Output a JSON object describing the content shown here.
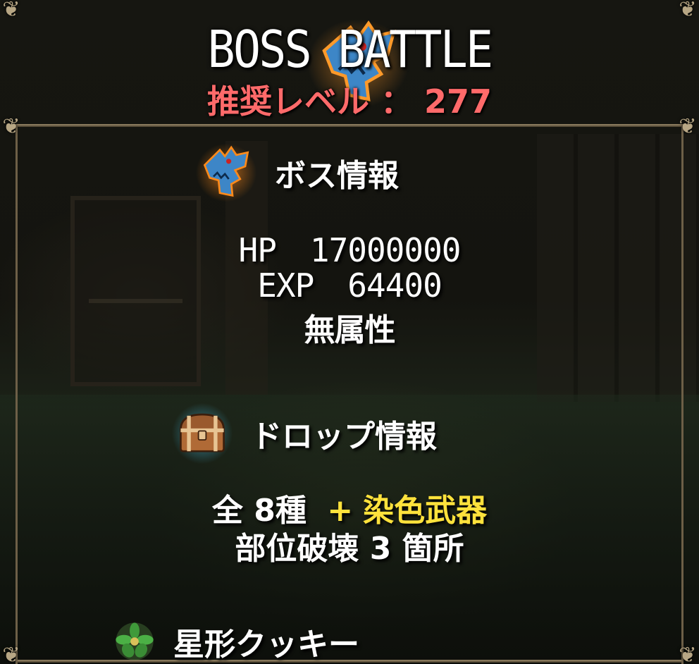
{
  "header": {
    "title_left": "BOSS",
    "title_right": "BATTLE",
    "recommended_level_label": "推奨レベル",
    "recommended_level_separator": "：",
    "recommended_level_value": "277"
  },
  "boss_info": {
    "heading": "ボス情報",
    "icon": "shark-head-icon",
    "hp_label": "HP",
    "hp_value": "17000000",
    "exp_label": "EXP",
    "exp_value": "64400",
    "attribute": "無属性"
  },
  "drop_info": {
    "heading": "ドロップ情報",
    "icon": "treasure-chest-icon",
    "total_prefix": "全",
    "total_kinds": "8種",
    "plus": "+",
    "extra": "染色武器",
    "part_break_label": "部位破壊",
    "part_break_count": "3",
    "part_break_suffix": "箇所"
  },
  "next_item": {
    "label": "星形クッキー",
    "icon": "leaf-cluster-icon"
  },
  "colors": {
    "level_red": "#ff6a6a",
    "highlight_yellow": "#ffe23c",
    "frame_gold": "#b7a684",
    "boss_icon_blue": "#3d86c7",
    "boss_icon_glow": "#ff9a2a"
  }
}
